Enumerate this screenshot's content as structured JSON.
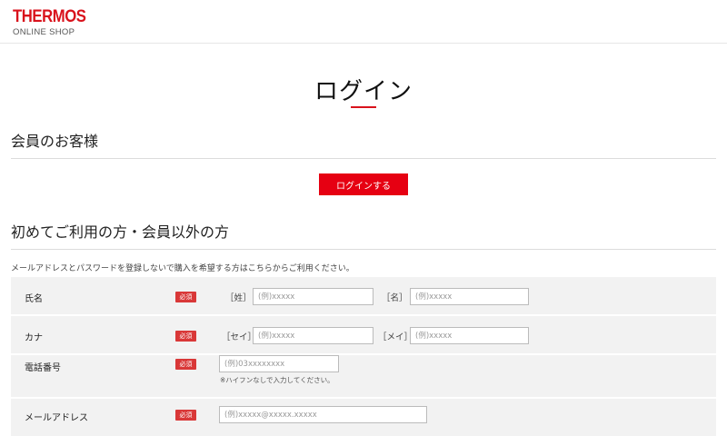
{
  "header": {
    "logo_main": "THERMOS",
    "logo_sub": "ONLINE SHOP"
  },
  "page": {
    "title": "ログイン"
  },
  "members": {
    "heading": "会員のお客様",
    "login_button": "ログインする"
  },
  "guests": {
    "heading": "初めてご利用の方・会員以外の方",
    "intro": "メールアドレスとパスワードを登録しないで購入を希望する方はこちらからご利用ください。",
    "required_label": "必須",
    "rows": {
      "name": {
        "label": "氏名",
        "last_bracket": "［姓］",
        "last_placeholder": "(例)xxxxx",
        "first_bracket": "［名］",
        "first_placeholder": "(例)xxxxx"
      },
      "kana": {
        "label": "カナ",
        "last_bracket": "［セイ］",
        "last_placeholder": "(例)xxxxx",
        "first_bracket": "［メイ］",
        "first_placeholder": "(例)xxxxx"
      },
      "phone": {
        "label": "電話番号",
        "placeholder": "(例)03xxxxxxxx",
        "note": "※ハイフンなしで入力してください。"
      },
      "email": {
        "label": "メールアドレス",
        "placeholder": "(例)xxxxx@xxxxx.xxxxx"
      }
    }
  }
}
